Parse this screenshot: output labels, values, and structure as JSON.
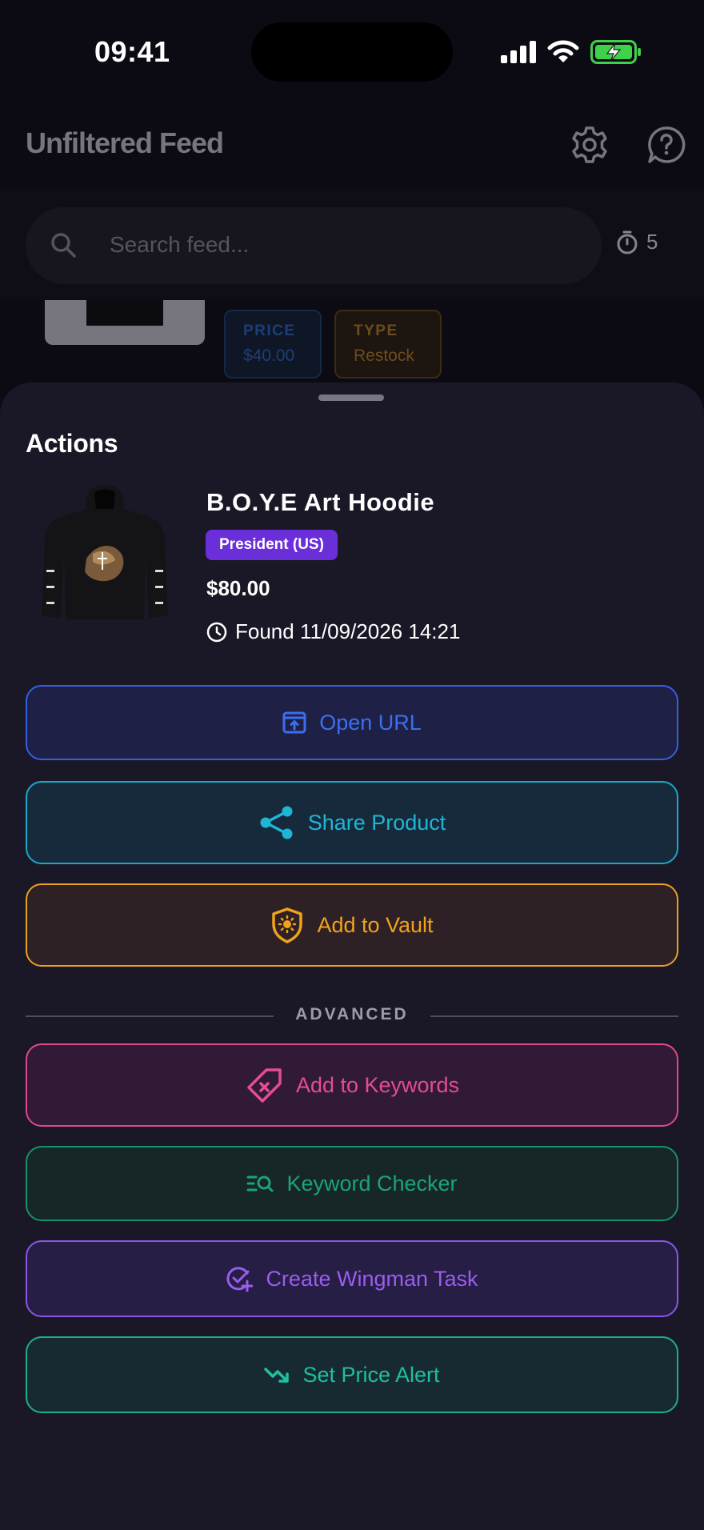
{
  "status_bar": {
    "time": "09:41"
  },
  "app": {
    "title": "Unfiltered Feed",
    "search": {
      "placeholder": "Search feed..."
    },
    "timer_count": "5",
    "tags": [
      {
        "label": "PRICE",
        "value": "$40.00"
      },
      {
        "label": "TYPE",
        "value": "Restock"
      }
    ]
  },
  "sheet": {
    "title": "Actions",
    "product": {
      "name": "B.O.Y.E Art Hoodie",
      "region": "President (US)",
      "price": "$80.00",
      "found": "Found 11/09/2026 14:21"
    },
    "actions": [
      {
        "label": "Open URL",
        "icon": "open-url-icon",
        "color": "#3b6ff0"
      },
      {
        "label": "Share Product",
        "icon": "share-icon",
        "color": "#1fb6d6"
      },
      {
        "label": "Add to Vault",
        "icon": "vault-shield-icon",
        "color": "#f0a21c"
      }
    ],
    "advanced_label": "ADVANCED",
    "advanced_actions": [
      {
        "label": "Add to Keywords",
        "icon": "tag-icon",
        "color": "#e54c93"
      },
      {
        "label": "Keyword Checker",
        "icon": "keyword-search-icon",
        "color": "#1aa37f"
      },
      {
        "label": "Create Wingman Task",
        "icon": "task-add-icon",
        "color": "#9b5cf0"
      },
      {
        "label": "Set Price Alert",
        "icon": "trend-down-icon",
        "color": "#1fbf9f"
      }
    ]
  }
}
